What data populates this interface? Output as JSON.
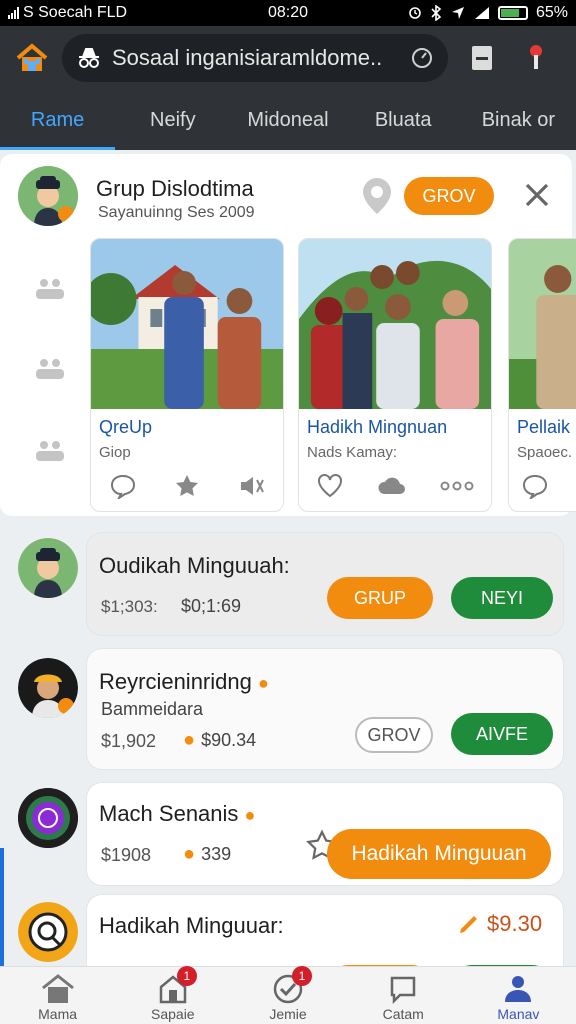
{
  "status_bar": {
    "carrier": "S Soecah FLD",
    "time": "08:20",
    "battery": "65%"
  },
  "app_bar": {
    "search_text": "Sosaal inganisiaramldome.."
  },
  "tabs": [
    {
      "label": "Rame",
      "active": true
    },
    {
      "label": "Neify",
      "active": false
    },
    {
      "label": "Midoneal",
      "active": false
    },
    {
      "label": "Bluata",
      "active": false
    },
    {
      "label": "Binak or",
      "active": false
    }
  ],
  "featured": {
    "title": "Grup Dislodtima",
    "subtitle": "Sayanuinng Ses 2009",
    "button": "GROV",
    "cards": [
      {
        "title": "QreUp",
        "subtitle": "Giop"
      },
      {
        "title": "Hadikh Mingnuan",
        "subtitle": "Nads Kamay:"
      },
      {
        "title": "Pellaik",
        "subtitle": "Spaoec."
      }
    ]
  },
  "feed": [
    {
      "title": "Oudikah Minguuah:",
      "meta1": "$1;303:",
      "meta2": "$0;1:69",
      "btn1": "GRUP",
      "btn2": "NEYI"
    },
    {
      "title": "Reyrcieninridng",
      "subtitle": "Bammeidara",
      "meta1": "$1,902",
      "meta2": "$90.34",
      "btn1": "GROV",
      "btn2": "AIVFE"
    },
    {
      "title": "Mach Senanis",
      "meta1": "$1908",
      "meta2": "339",
      "btn1": "Hadikah Minguuan"
    },
    {
      "title": "Hadikah Minguuar:",
      "price": "$9.30"
    }
  ],
  "bottom_nav": [
    {
      "label": "Mama",
      "badge": ""
    },
    {
      "label": "Sapaie",
      "badge": "1"
    },
    {
      "label": "Jemie",
      "badge": "1"
    },
    {
      "label": "Catam",
      "badge": ""
    },
    {
      "label": "Manav",
      "badge": ""
    }
  ],
  "colors": {
    "accent": "#40a9ff",
    "orange": "#f28c0f",
    "green": "#1e8c3a",
    "appbar": "#2f3338"
  }
}
